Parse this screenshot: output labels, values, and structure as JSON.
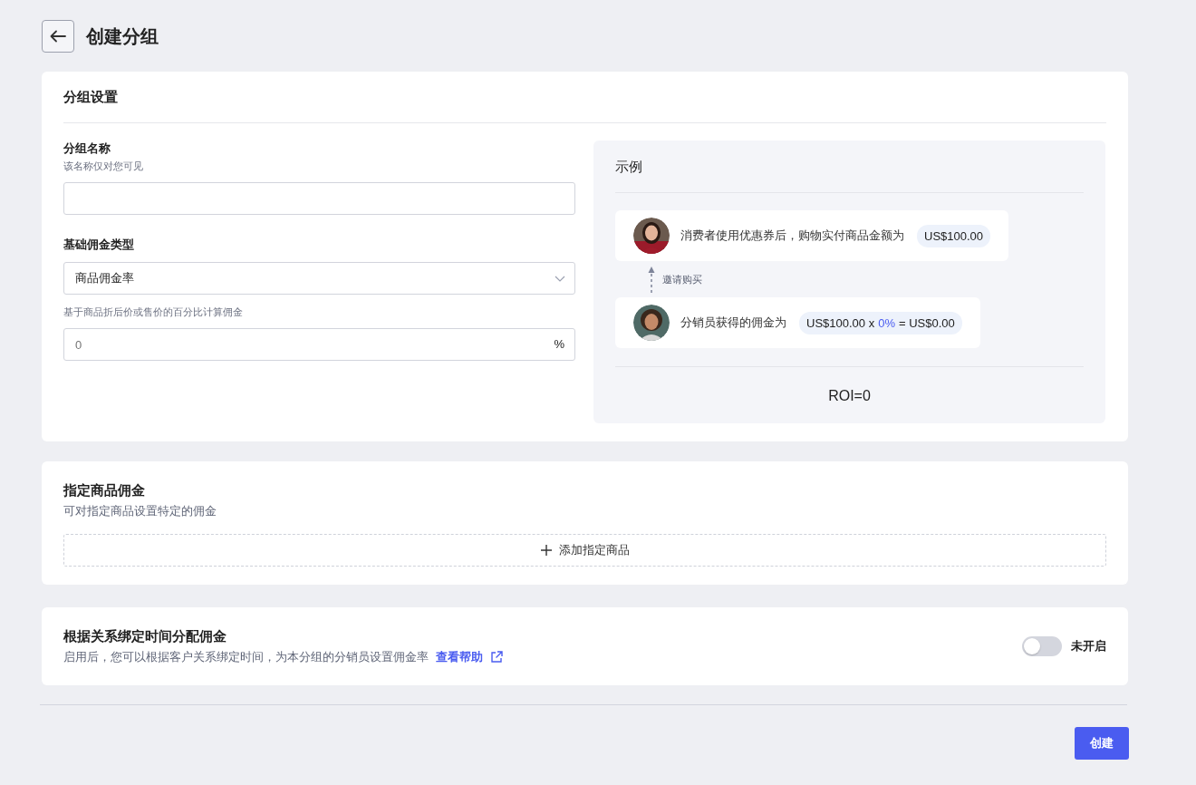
{
  "page": {
    "title": "创建分组"
  },
  "group_settings": {
    "title": "分组设置",
    "name_field": {
      "label": "分组名称",
      "hint": "该名称仅对您可见"
    },
    "commission_type": {
      "label": "基础佣金类型",
      "value": "商品佣金率",
      "hint": "基于商品折后价或售价的百分比计算佣金"
    },
    "rate_field": {
      "placeholder": "0",
      "suffix": "%"
    },
    "example": {
      "title": "示例",
      "consumer": {
        "text": "消费者使用优惠券后，购物实付商品金额为",
        "amount": "US$100.00"
      },
      "invite_label": "邀请购买",
      "affiliate": {
        "text": "分销员获得的佣金为",
        "formula_left": "US$100.00 x",
        "rate": "0%",
        "formula_right": "= US$0.00"
      },
      "roi": "ROI=0"
    }
  },
  "product_commission": {
    "title": "指定商品佣金",
    "subtitle": "可对指定商品设置特定的佣金",
    "add_button": "添加指定商品"
  },
  "binding_time": {
    "title": "根据关系绑定时间分配佣金",
    "subtitle": "启用后，您可以根据客户关系绑定时间，为本分组的分销员设置佣金率",
    "help_link": "查看帮助",
    "on": false,
    "status": "未开启"
  },
  "create_button": "创建"
}
